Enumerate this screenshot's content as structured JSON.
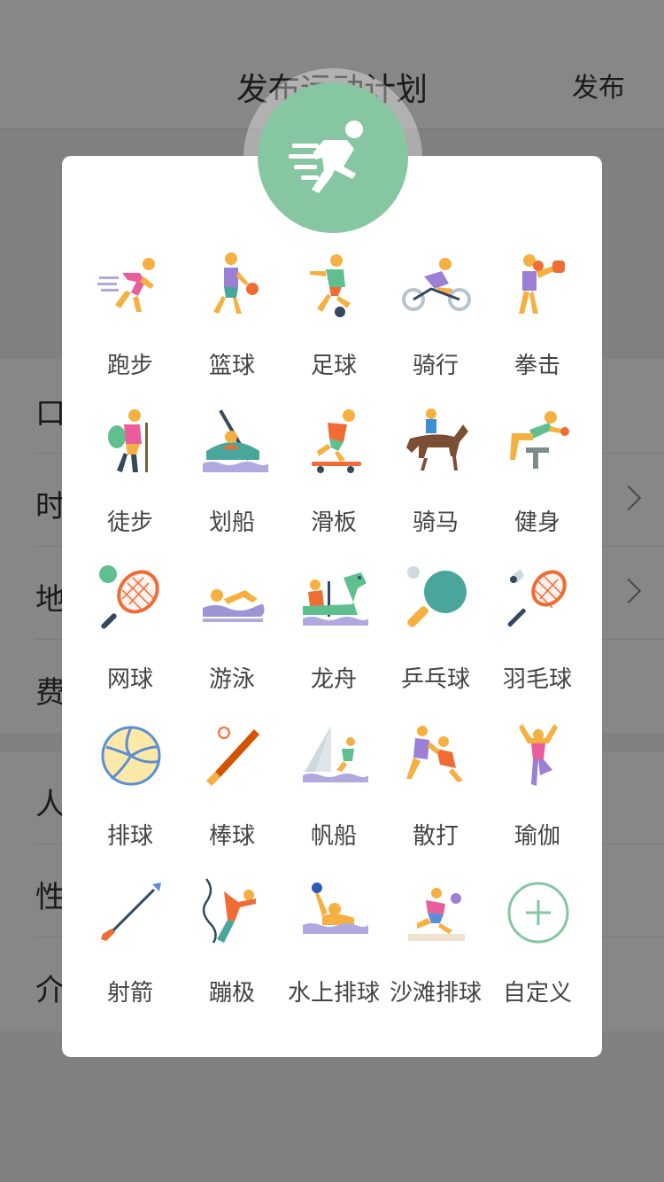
{
  "background": {
    "title": "发布运动计划",
    "publish_label": "发布",
    "rows": [
      {
        "label": "口"
      },
      {
        "label": "时"
      },
      {
        "label": "地"
      },
      {
        "label": "费"
      },
      {
        "label": "人"
      },
      {
        "label": "性"
      },
      {
        "label": "介"
      }
    ]
  },
  "modal": {
    "hero_icon": "running-person-icon",
    "hero_color": "#86c6a1",
    "sports": [
      {
        "label": "跑步",
        "icon": "running-icon"
      },
      {
        "label": "篮球",
        "icon": "basketball-icon"
      },
      {
        "label": "足球",
        "icon": "soccer-icon"
      },
      {
        "label": "骑行",
        "icon": "cycling-icon"
      },
      {
        "label": "拳击",
        "icon": "boxing-icon"
      },
      {
        "label": "徒步",
        "icon": "hiking-icon"
      },
      {
        "label": "划船",
        "icon": "rowing-icon"
      },
      {
        "label": "滑板",
        "icon": "skateboard-icon"
      },
      {
        "label": "骑马",
        "icon": "horse-riding-icon"
      },
      {
        "label": "健身",
        "icon": "fitness-icon"
      },
      {
        "label": "网球",
        "icon": "tennis-icon"
      },
      {
        "label": "游泳",
        "icon": "swimming-icon"
      },
      {
        "label": "龙舟",
        "icon": "dragon-boat-icon"
      },
      {
        "label": "乒乓球",
        "icon": "ping-pong-icon"
      },
      {
        "label": "羽毛球",
        "icon": "badminton-icon"
      },
      {
        "label": "排球",
        "icon": "volleyball-icon"
      },
      {
        "label": "棒球",
        "icon": "baseball-icon"
      },
      {
        "label": "帆船",
        "icon": "sailing-icon"
      },
      {
        "label": "散打",
        "icon": "sanda-icon"
      },
      {
        "label": "瑜伽",
        "icon": "yoga-icon"
      },
      {
        "label": "射箭",
        "icon": "archery-icon"
      },
      {
        "label": "蹦极",
        "icon": "bungee-icon"
      },
      {
        "label": "水上排球",
        "icon": "water-polo-icon"
      },
      {
        "label": "沙滩排球",
        "icon": "beach-volleyball-icon"
      },
      {
        "label": "自定义",
        "icon": "add-custom-icon"
      }
    ]
  }
}
